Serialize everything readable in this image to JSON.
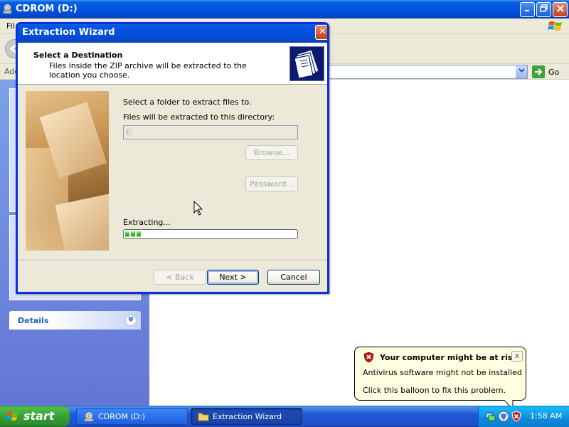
{
  "explorer": {
    "title": "CDROM (D:)",
    "menu_first_letter": "Fil",
    "address_label": "Add",
    "go_label": "Go",
    "details_label": "Details"
  },
  "wizard": {
    "title": "Extraction Wizard",
    "heading": "Select a Destination",
    "description": "Files inside the ZIP archive will be extracted to the location you choose.",
    "prompt": "Select a folder to extract files to.",
    "dir_label": "Files will be extracted to this directory:",
    "dir_value": "E:",
    "browse_label": "Browse...",
    "password_label": "Password...",
    "extracting_label": "Extracting...",
    "progress_fraction": 0.1,
    "back_label": "< Back",
    "next_label": "Next >",
    "cancel_label": "Cancel",
    "close_glyph": "✕"
  },
  "balloon": {
    "title": "Your computer might be at risk",
    "line1": "Antivirus software might not be installed",
    "line2": "Click this balloon to fix this problem.",
    "close_glyph": "x"
  },
  "taskbar": {
    "start_label": "start",
    "tasks": [
      {
        "label": "CDROM (D:)",
        "icon": "cdrom-icon"
      },
      {
        "label": "Extraction Wizard",
        "icon": "folder-icon"
      }
    ],
    "clock": "1:58 AM",
    "tray_icons": [
      "network-icon",
      "security-center-icon",
      "security-alert-icon"
    ]
  },
  "colors": {
    "title_blue": "#0054e3",
    "taskbar_blue": "#2157d7",
    "start_green": "#35a035",
    "balloon_yellow": "#ffffe1",
    "progress_green": "#3ec12a"
  }
}
